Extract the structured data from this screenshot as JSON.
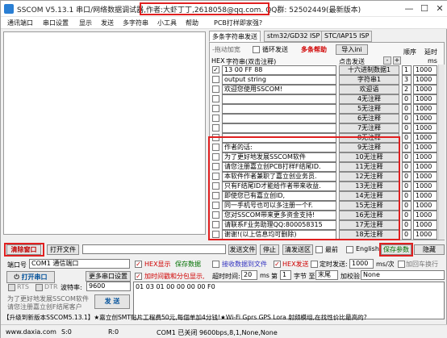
{
  "window": {
    "title_prefix": "SSCOM V5.13.1 串口/网络数据调试器,",
    "title_author": "作者:大虾丁丁,2618058@qq.com.",
    "title_suffix": " QQ群: 52502449(最新版本)",
    "min": "—",
    "max": "☐",
    "close": "✕"
  },
  "menu": [
    "通讯端口",
    "串口设置",
    "显示",
    "发送",
    "多字符串",
    "小工具",
    "帮助",
    "PCB打样即家强?"
  ],
  "tabs": [
    "多条字符串发送",
    "stm32/GD32 ISP",
    "STC/IAP15 ISP"
  ],
  "panel": {
    "drag_label": "-拖动加宽",
    "loop_label": "循环发送",
    "help_label": "多条帮助",
    "import_label": "导入ini",
    "hex_col": "HEX",
    "str_col": "字符串(双击注释)",
    "click_col": "点击发送",
    "minus": "-",
    "plus": "+",
    "order_col": "顺序",
    "delay_col": "延时",
    "ms": "ms"
  },
  "rows": [
    {
      "hex": true,
      "text": "13 00 FF 88",
      "btn": "十六进制数据1",
      "order": "1",
      "delay": "1000"
    },
    {
      "hex": false,
      "text": "output string",
      "btn": "字符串1",
      "order": "3",
      "delay": "1000"
    },
    {
      "hex": false,
      "text": "欢迎您使用SSCOM!",
      "btn": "欢迎语",
      "order": "2",
      "delay": "1000"
    },
    {
      "hex": false,
      "text": "",
      "btn": "4无注释",
      "order": "0",
      "delay": "1000"
    },
    {
      "hex": false,
      "text": "",
      "btn": "5无注释",
      "order": "0",
      "delay": "1000"
    },
    {
      "hex": false,
      "text": "",
      "btn": "6无注释",
      "order": "0",
      "delay": "1000"
    },
    {
      "hex": false,
      "text": "",
      "btn": "7无注释",
      "order": "0",
      "delay": "1000"
    },
    {
      "hex": false,
      "text": "",
      "btn": "8无注释",
      "order": "0",
      "delay": "1000"
    },
    {
      "hex": false,
      "text": "作者的话:",
      "btn": "9无注释",
      "order": "0",
      "delay": "1000"
    },
    {
      "hex": false,
      "text": "为了更好地发展SSCOM软件",
      "btn": "10无注释",
      "order": "0",
      "delay": "1000"
    },
    {
      "hex": false,
      "text": "请您注册嘉立创PCB打样F结尾ID.",
      "btn": "11无注释",
      "order": "0",
      "delay": "1000"
    },
    {
      "hex": false,
      "text": "本软件作者兼职了嘉立创业务员.",
      "btn": "12无注释",
      "order": "0",
      "delay": "1000"
    },
    {
      "hex": false,
      "text": "只有F结尾ID才能给作者带来收益.",
      "btn": "13无注释",
      "order": "0",
      "delay": "1000"
    },
    {
      "hex": false,
      "text": "即使您已有嘉立创ID,",
      "btn": "14无注释",
      "order": "0",
      "delay": "1000"
    },
    {
      "hex": false,
      "text": "同一手机号也可以多注册一个F.",
      "btn": "15无注释",
      "order": "0",
      "delay": "1000"
    },
    {
      "hex": false,
      "text": "您对SSCOM带来更多资金支持!",
      "btn": "16无注释",
      "order": "0",
      "delay": "1000"
    },
    {
      "hex": false,
      "text": "请联系F业务助理QQ:800058315",
      "btn": "17无注释",
      "order": "0",
      "delay": "1000"
    },
    {
      "hex": false,
      "text": "谢谢!(以上信息均可删除)",
      "btn": "18无注释",
      "order": "0",
      "delay": "1000"
    }
  ],
  "toolbar": {
    "clear_window": "清除窗口",
    "open_file": "打开文件",
    "send_file": "发送文件",
    "stop": "停止",
    "clear_send": "清发送区",
    "front": "最前",
    "english": "English",
    "save_params": "保存参数",
    "expand": "隐藏"
  },
  "port": {
    "port_label": "端口号",
    "port_value": "COM1 通信端口",
    "hex_display": "HEX显示",
    "save_data": "保存数据",
    "recv_to_file": "接收数据到文件",
    "hex_send": "HEX发送",
    "timed_send": "定时发送:",
    "interval": "1000",
    "interval_unit": "ms/次",
    "add_enter": "加回车换行",
    "open_port": "打开串口",
    "more_settings": "更多串口设置",
    "timestamp": "加时间戳和分包显示,",
    "timeout_label": "超时时间:",
    "timeout": "20",
    "ms": "ms",
    "nth": "第",
    "byte_no": "1",
    "byte_to": "字节 至",
    "end": "末尾",
    "verify_label": "加校验",
    "verify": "None",
    "rts": "RTS",
    "dtr": "DTR",
    "baud_label": "波特率:",
    "baud": "9600",
    "send_text": "01 03 01 00 00 00 00 F0",
    "send_button": "发 送",
    "notice1": "为了更好地发展SSCOM软件",
    "notice2": "请您注册嘉立创F结尾客户"
  },
  "ad": "【升级到新版本SSCOM5.13.1】★嘉立创SMT贴片工程费50元,每個单加4分钱!★Wi-Fi Gprs GPS Lora 射频模组,在找性价比最高的?",
  "status": {
    "site": "www.daxia.com",
    "s": "S:0",
    "r": "R:0",
    "port_state": "COM1 已关闭  9600bps,8,1,None,None"
  },
  "colors": {
    "accent": "#e02020",
    "title_icon": "#2a7fd4"
  }
}
